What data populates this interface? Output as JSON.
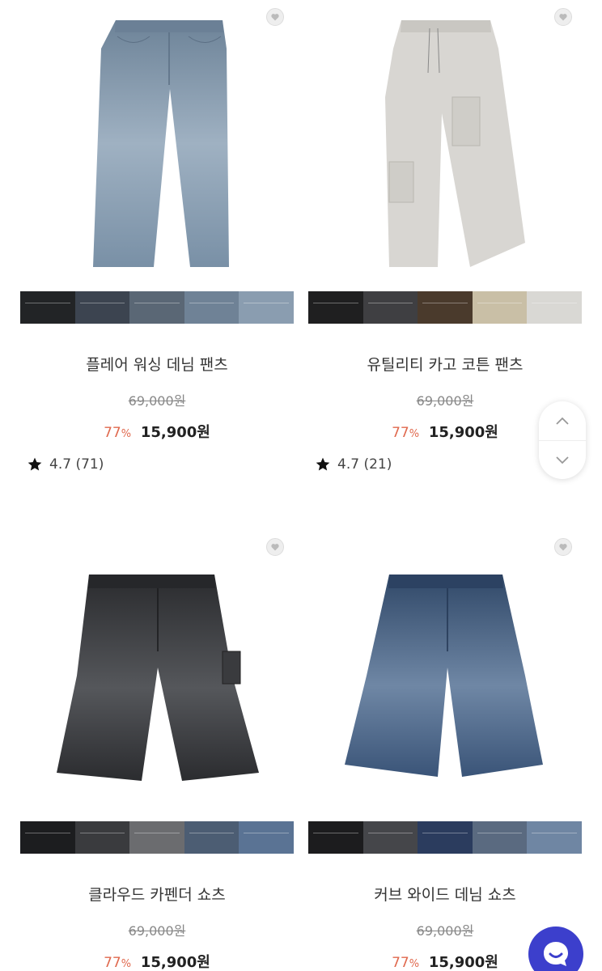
{
  "products": [
    {
      "name": "플레어 워싱 데님 팬츠",
      "original_price": "69,000원",
      "discount": "77",
      "discount_unit": "%",
      "price": "15,900원",
      "rating": "4.7 (71)",
      "image_icon": "light-blue-flare-jeans",
      "swatch_colors": [
        "#222426",
        "#3c4450",
        "#5a6775",
        "#6f8296",
        "#8a9db0"
      ]
    },
    {
      "name": "유틸리티 카고 코튼 팬츠",
      "original_price": "69,000원",
      "discount": "77",
      "discount_unit": "%",
      "price": "15,900원",
      "rating": "4.7 (21)",
      "image_icon": "light-grey-cargo-pants",
      "swatch_colors": [
        "#1f1f20",
        "#3f3f42",
        "#4a3a2c",
        "#c9bfa6",
        "#d9d8d4"
      ]
    },
    {
      "name": "클라우드 카펜더 쇼츠",
      "original_price": "69,000원",
      "discount": "77",
      "discount_unit": "%",
      "price": "15,900원",
      "image_icon": "black-denim-shorts",
      "swatch_colors": [
        "#1c1d1f",
        "#3a3b3e",
        "#6b6c6f",
        "#4c5d73",
        "#5a7394"
      ]
    },
    {
      "name": "커브 와이드 데님 쇼츠",
      "original_price": "69,000원",
      "discount": "77",
      "discount_unit": "%",
      "price": "15,900원",
      "image_icon": "blue-denim-shorts",
      "swatch_colors": [
        "#1c1c1e",
        "#45464a",
        "#2b3c5e",
        "#5a6a80",
        "#6f86a3"
      ]
    }
  ],
  "scroll_controls": {
    "up_icon": "chevron-up-icon",
    "down_icon": "chevron-down-icon"
  },
  "chat_icon": "chat-bubble-icon",
  "colors": {
    "discount": "#e0694e",
    "chat_button": "#3c3fcc"
  }
}
